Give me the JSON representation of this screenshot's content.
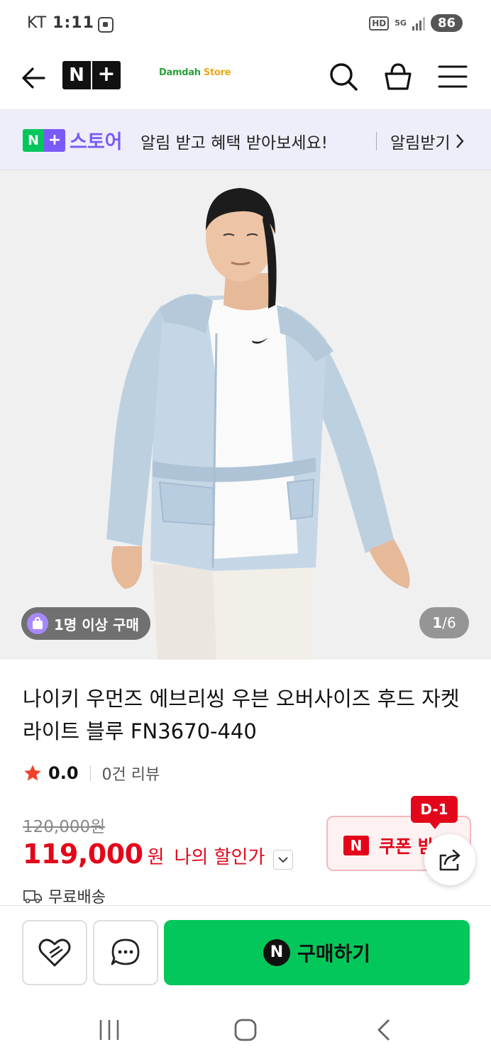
{
  "status_bar": {
    "carrier": "KT",
    "time": "1:11",
    "hd": "HD",
    "network": "5G",
    "battery": "86"
  },
  "header": {
    "logo_n": "N",
    "logo_plus": "+",
    "store_name_a": "Damdah",
    "store_name_b": "Store"
  },
  "notice": {
    "badge_n": "N",
    "badge_plus": "+",
    "brand": "스토어",
    "message": "알림 받고 혜택 받아보세요!",
    "cta": "알림받기"
  },
  "gallery": {
    "buyer_badge": "1명 이상 구매",
    "current": "1",
    "total": "/6"
  },
  "product": {
    "title": "나이키 우먼즈 에브리씽 우븐 오버사이즈 후드 자켓 라이트 블루 FN3670-440",
    "rating": "0.0",
    "reviews": "0건 리뷰",
    "original_price": "120,000원",
    "price": "119,000",
    "price_unit": "원",
    "discount_label": "나의 할인가",
    "coupon_label": "쿠폰 받기",
    "coupon_n": "N",
    "dday": "D-1",
    "shipping": "무료배송"
  },
  "actions": {
    "buy_n": "N",
    "buy_label": "구매하기"
  },
  "colors": {
    "naver_green": "#03c75a",
    "price_red": "#e3061a",
    "plus_purple": "#7a5af8",
    "jacket": "#c5d7e6"
  },
  "icons": [
    "back-icon",
    "search-icon",
    "cart-icon",
    "menu-icon",
    "chevron-right-icon",
    "bag-icon",
    "star-icon",
    "chevron-down-icon",
    "share-icon",
    "truck-icon",
    "heart-icon",
    "chat-icon",
    "recents-icon",
    "home-icon",
    "nav-back-icon"
  ]
}
